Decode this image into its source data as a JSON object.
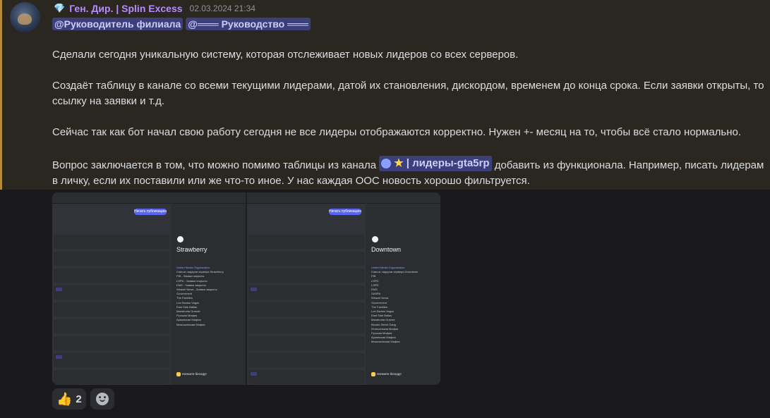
{
  "message": {
    "author_badge_icon": "gem-icon",
    "author": "Ген. Дир. | Splin Excess",
    "timestamp": "02.03.2024 21:34",
    "mentions": [
      "@Руководитель филиала",
      "@═══ Руководство ═══"
    ],
    "paragraphs": [
      "Сделали сегодня уникальную систему, которая отслеживает новых лидеров со всех серверов.",
      "Создаёт таблицу в канале со всеми текущими лидерами, датой их становления, дискордом, временем до конца срока. Если заявки открыты, то ссылку на заявки и т.д.",
      "Сейчас так как бот начал свою работу сегодня не все лидеры отображаются корректно. Нужен +- месяц на то, чтобы всё стало нормально."
    ],
    "last_paragraph_before": "Вопрос заключается в том, что можно помимо таблицы из канала",
    "channel_mention": "| лидеры-gta5rp",
    "last_paragraph_after": "добавить из функционала. Например, писать лидерам в личку, если их поставили или же что-то иное. У нас каждая ООС новость хорошо фильтруется."
  },
  "attachments": [
    {
      "panel_title": "Strawberry",
      "publish_button": "Начать публикацию",
      "footer": "Начните беседу!",
      "lines": [
        "United Media Organization",
        "Список лидеров сервера Strawberry",
        "FIB - Заявки закрыты",
        "LSPD - Заявки открыты",
        "EMS - Заявки закрыты",
        "Weazel News - Заявки закрыты",
        "Government",
        "The Families",
        "Los Santos Vagos",
        "East Side Ballas",
        "Marabunta Grande",
        "Русская Мафия",
        "Армянская Мафия",
        "Мексиканская Мафия"
      ]
    },
    {
      "panel_title": "Downtown",
      "publish_button": "Начать публикацию",
      "footer": "Начните беседу!",
      "lines": [
        "United Media Organization",
        "Список лидеров сервера Downtown",
        "FIB",
        "LSPD",
        "LSPD",
        "EMS",
        "SASPA",
        "Weazel News",
        "Government",
        "The Families",
        "Los Santos Vagos",
        "East Side Ballas",
        "Marabunta Grande",
        "Bloods Street Gang",
        "Итальянская Мафия",
        "Русская Мафия",
        "Армянская Мафия",
        "Мексиканская Мафия"
      ]
    }
  ],
  "reactions": [
    {
      "icon": "thumbs-up-icon",
      "count": "2"
    },
    {
      "icon": "add-reaction-icon",
      "count": ""
    }
  ]
}
